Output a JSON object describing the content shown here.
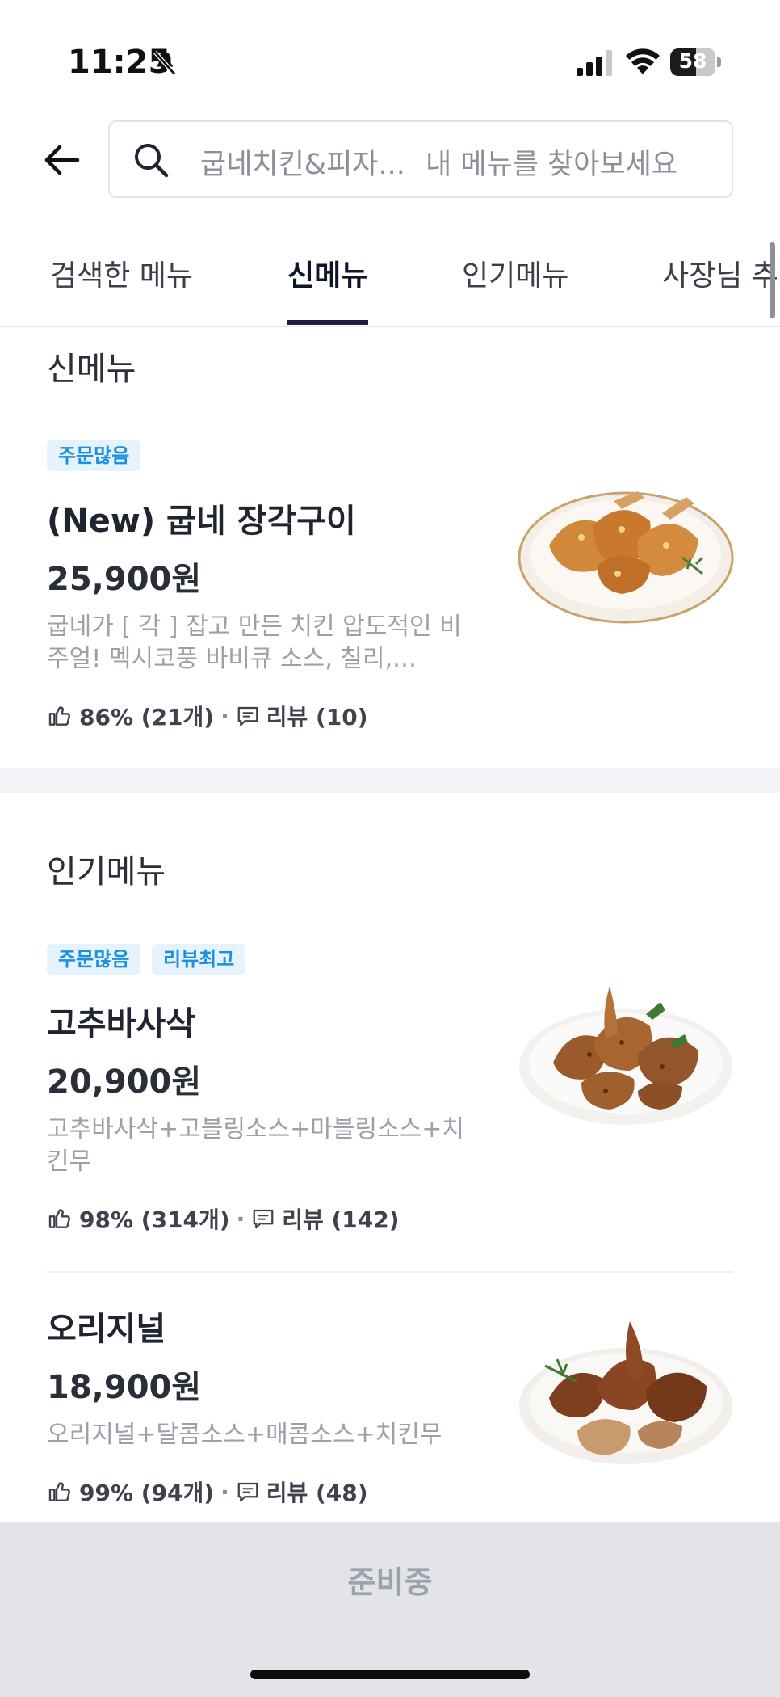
{
  "status_bar": {
    "time": "11:25",
    "battery": "58"
  },
  "header": {
    "search_store": "굽네치킨&피자...",
    "search_placeholder": "내 메뉴를 찾아보세요"
  },
  "tabs": [
    "검색한 메뉴",
    "신메뉴",
    "인기메뉴",
    "사장님 추"
  ],
  "active_tab": "신메뉴",
  "sections": [
    {
      "title": "신메뉴",
      "items": [
        {
          "badges": [
            "주문많음"
          ],
          "name": "(New) 굽네 장각구이",
          "price": "25,900원",
          "description": "굽네가 [ 각 ] 잡고 만든 치킨 압도적인 비주얼! 멕시코풍 바비큐 소스, 칠리,…",
          "rating": "86% (21개)",
          "reviews": "리뷰 (10)"
        }
      ]
    },
    {
      "title": "인기메뉴",
      "items": [
        {
          "badges": [
            "주문많음",
            "리뷰최고"
          ],
          "name": "고추바사삭",
          "price": "20,900원",
          "description": "고추바사삭+고블링소스+마블링소스+치킨무",
          "rating": "98% (314개)",
          "reviews": "리뷰 (142)"
        },
        {
          "badges": [],
          "name": "오리지널",
          "price": "18,900원",
          "description": "오리지널+달콤소스+매콤소스+치킨무",
          "rating": "99% (94개)",
          "reviews": "리뷰 (48)"
        }
      ]
    }
  ],
  "footer": {
    "label": "준비중"
  },
  "colors": {
    "badge_bg": "#e4f3fd",
    "badge_text": "#1c8fe0",
    "tab_underline": "#1c1f3a",
    "footer_bg": "#e2e4e8"
  }
}
